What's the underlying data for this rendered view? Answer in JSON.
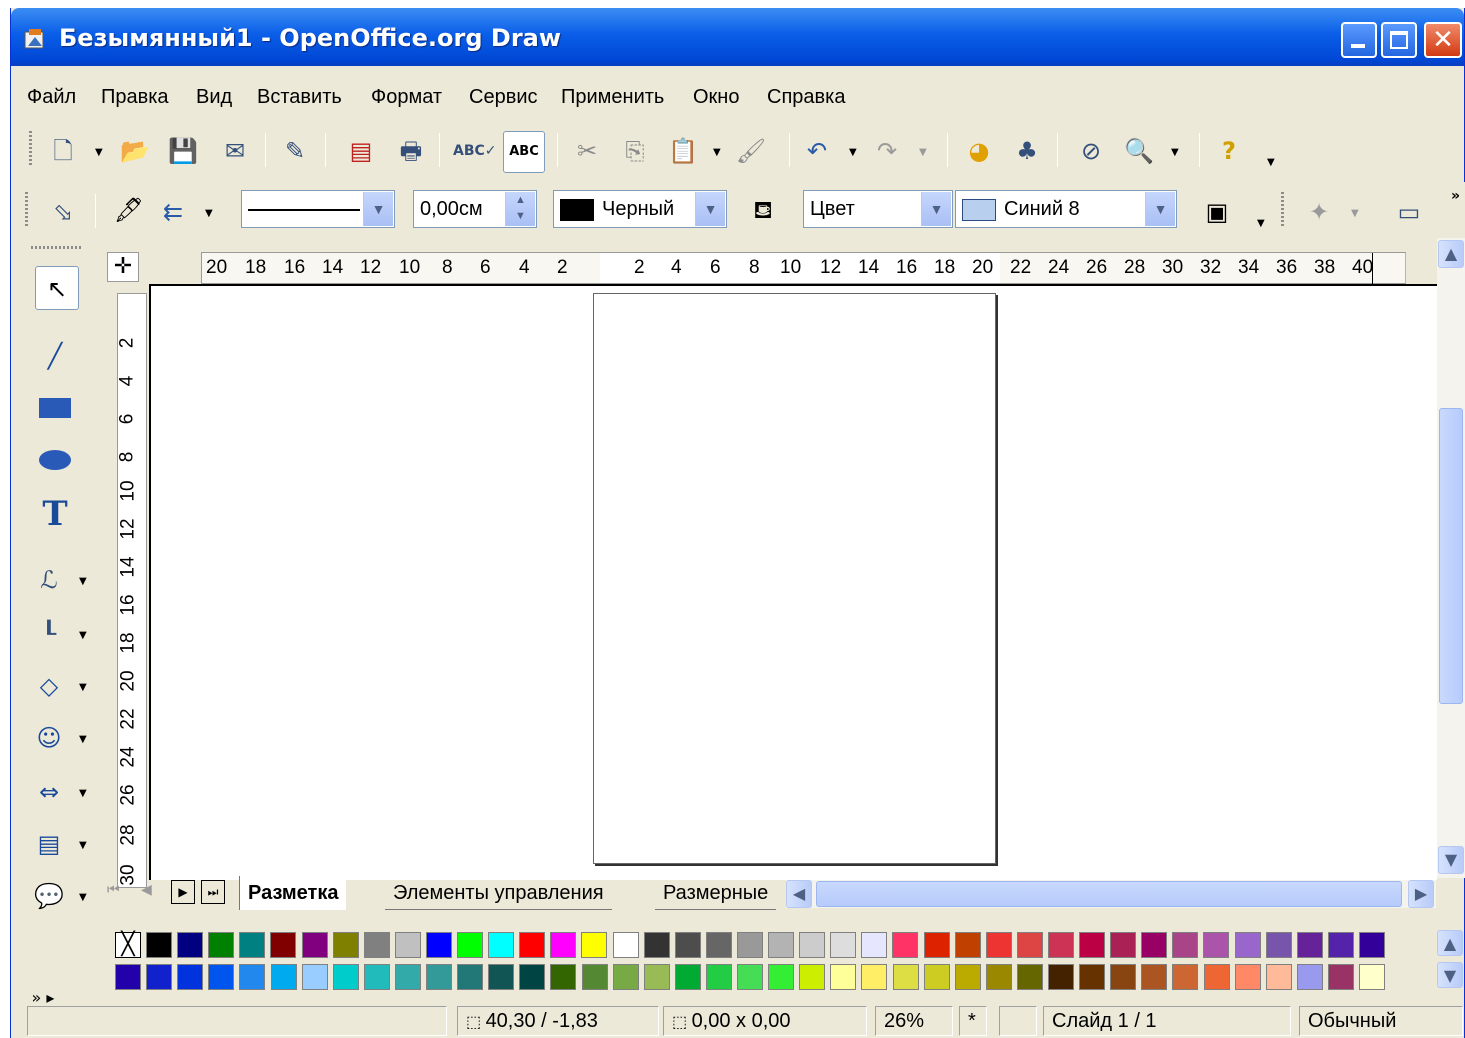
{
  "window": {
    "title": "Безымянный1 - OpenOffice.org Draw"
  },
  "menu": [
    "Файл",
    "Правка",
    "Вид",
    "Вставить",
    "Формат",
    "Сервис",
    "Применить",
    "Окно",
    "Справка"
  ],
  "line_toolbar": {
    "line_width": "0,00см",
    "line_color": "Черный",
    "area_style": "Цвет",
    "area_color": "Синий 8"
  },
  "ruler_h": [
    "20",
    "18",
    "16",
    "14",
    "12",
    "10",
    "8",
    "6",
    "4",
    "2",
    "2",
    "4",
    "6",
    "8",
    "10",
    "12",
    "14",
    "16",
    "18",
    "20",
    "22",
    "24",
    "26",
    "28",
    "30",
    "32",
    "34",
    "36",
    "38",
    "40"
  ],
  "ruler_v": [
    "2",
    "4",
    "6",
    "8",
    "10",
    "12",
    "14",
    "16",
    "18",
    "20",
    "22",
    "24",
    "26",
    "28",
    "30"
  ],
  "tabs": [
    "Разметка",
    "Элементы управления",
    "Размерные"
  ],
  "status": {
    "position": "40,30 / -1,83",
    "size": "0,00 x 0,00",
    "zoom": "26%",
    "modified": "*",
    "slide": "Слайд 1 / 1",
    "layout": "Обычный"
  },
  "palette_row1": [
    "#000000",
    "#000080",
    "#008000",
    "#008080",
    "#800000",
    "#800080",
    "#808000",
    "#808080",
    "#c0c0c0",
    "#0000ff",
    "#00ff00",
    "#00ffff",
    "#ff0000",
    "#ff00ff",
    "#ffff00",
    "#ffffff",
    "#333333",
    "#4d4d4d",
    "#666666",
    "#999999",
    "#b3b3b3",
    "#cccccc",
    "#dddddd",
    "#e6e6ff",
    "#ff3366",
    "#dd2200",
    "#c04000",
    "#ee3333",
    "#dd4444",
    "#cc3355",
    "#bb0044",
    "#aa2255",
    "#990066",
    "#aa4488",
    "#aa55aa",
    "#9966cc",
    "#7755aa",
    "#662299",
    "#5522aa",
    "#330099"
  ],
  "palette_row2": [
    "#2200aa",
    "#1122cc",
    "#0033dd",
    "#0055ee",
    "#2288ee",
    "#00aaee",
    "#99ccff",
    "#00cccc",
    "#22bbbb",
    "#33aaaa",
    "#339999",
    "#227777",
    "#115555",
    "#004444",
    "#336600",
    "#558833",
    "#77aa44",
    "#99bb55",
    "#00aa33",
    "#22cc44",
    "#44dd55",
    "#33ee33",
    "#ccee00",
    "#ffff99",
    "#ffee66",
    "#dddd44",
    "#cccc22",
    "#bbaa00",
    "#998800",
    "#666600",
    "#442200",
    "#663300",
    "#884411",
    "#aa5522",
    "#cc6633",
    "#ee6633",
    "#ff8866",
    "#ffbb99",
    "#9999ee",
    "#993366",
    "#ffffcc"
  ]
}
